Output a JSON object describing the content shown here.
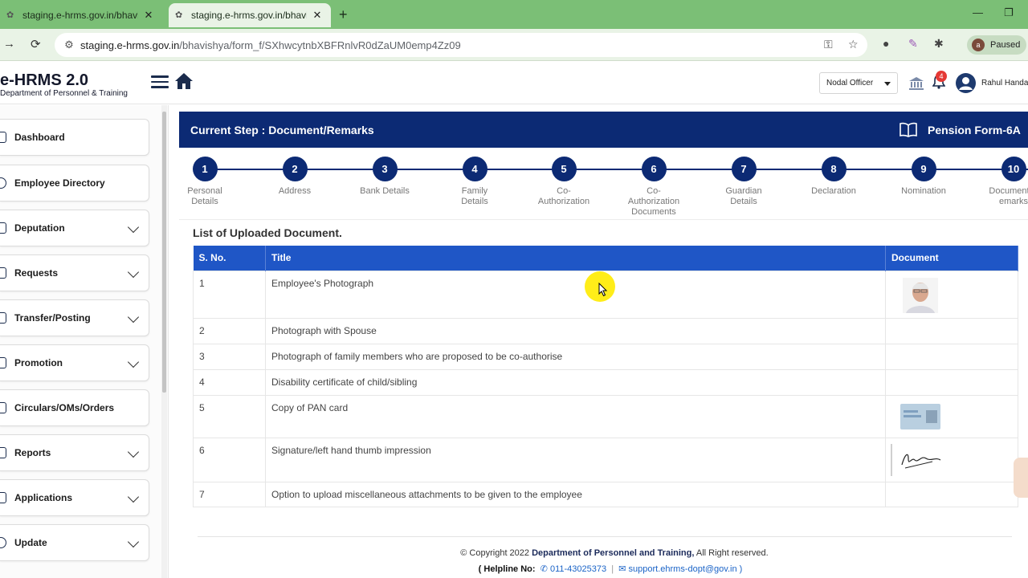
{
  "browser": {
    "tabs": [
      {
        "title": "staging.e-hrms.gov.in/bhavishya",
        "active": false
      },
      {
        "title": "staging.e-hrms.gov.in/bhavishya",
        "active": true
      }
    ],
    "url_host": "staging.e-hrms.gov.in",
    "url_path": "/bhavishya/form_f/SXhwcytnbXBFRnlvR0dZaUM0emp4Zz09",
    "profile_initial": "a",
    "profile_status": "Paused"
  },
  "header": {
    "logo_title": "e-HRMS 2.0",
    "logo_subtitle": "Department of Personnel & Training",
    "role_selected": "Nodal Officer",
    "notification_count": "4",
    "user_name": "Rahul Handa"
  },
  "sidebar": {
    "items": [
      {
        "label": "Dashboard",
        "has_submenu": false
      },
      {
        "label": "Employee Directory",
        "has_submenu": false
      },
      {
        "label": "Deputation",
        "has_submenu": true
      },
      {
        "label": "Requests",
        "has_submenu": true
      },
      {
        "label": "Transfer/Posting",
        "has_submenu": true
      },
      {
        "label": "Promotion",
        "has_submenu": true
      },
      {
        "label": "Circulars/OMs/Orders",
        "has_submenu": false
      },
      {
        "label": "Reports",
        "has_submenu": true
      },
      {
        "label": "Applications",
        "has_submenu": true
      },
      {
        "label": "Update",
        "has_submenu": true
      }
    ]
  },
  "form": {
    "current_step": "Current Step : Document/Remarks",
    "form_name": "Pension Form-6A",
    "steps": [
      {
        "num": "1",
        "label": "Personal Details"
      },
      {
        "num": "2",
        "label": "Address"
      },
      {
        "num": "3",
        "label": "Bank Details"
      },
      {
        "num": "4",
        "label": "Family Details"
      },
      {
        "num": "5",
        "label": "Co-Authorization"
      },
      {
        "num": "6",
        "label": "Co-Authorization Documents"
      },
      {
        "num": "7",
        "label": "Guardian Details"
      },
      {
        "num": "8",
        "label": "Declaration"
      },
      {
        "num": "9",
        "label": "Nomination"
      },
      {
        "num": "10",
        "label": "Document/Remarks"
      }
    ]
  },
  "documents": {
    "section_title": "List of Uploaded Document.",
    "columns": [
      "S. No.",
      "Title",
      "Document"
    ],
    "rows": [
      {
        "sno": "1",
        "title": "Employee's Photograph",
        "document": "photo"
      },
      {
        "sno": "2",
        "title": "Photograph with Spouse",
        "document": ""
      },
      {
        "sno": "3",
        "title": "Photograph of family members who are proposed to be co-authorise",
        "document": ""
      },
      {
        "sno": "4",
        "title": "Disability certificate of child/sibling",
        "document": ""
      },
      {
        "sno": "5",
        "title": "Copy of PAN card",
        "document": "pan"
      },
      {
        "sno": "6",
        "title": "Signature/left hand thumb impression",
        "document": "signature"
      },
      {
        "sno": "7",
        "title": "Option to upload miscellaneous attachments to be given to the employee",
        "document": ""
      }
    ]
  },
  "footer": {
    "copyright_prefix": "© Copyright 2022",
    "org": "Department of Personnel and Training,",
    "rights": "All Right reserved.",
    "helpline_label": "( Helpline No:",
    "phone": "011-43025373",
    "email": "support.ehrms-dopt@gov.in )"
  },
  "colors": {
    "brand_navy": "#0c2a74",
    "table_header": "#1f56c6",
    "browser_tabbar": "#7bbf76"
  }
}
